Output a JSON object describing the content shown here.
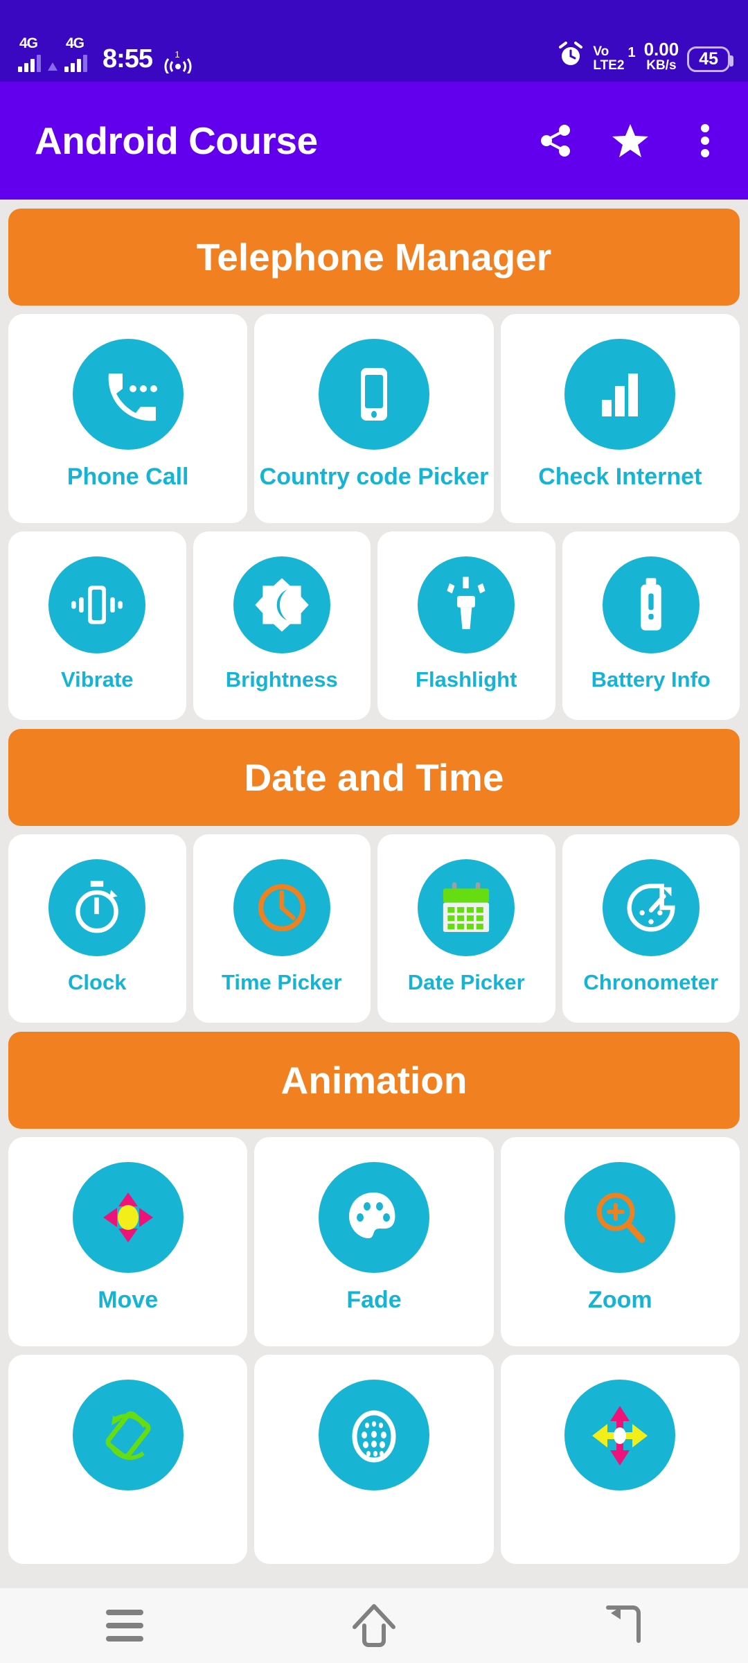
{
  "status_bar": {
    "network_1": "4G",
    "network_2": "4G",
    "time": "8:55",
    "hotspot_count": "1",
    "alarm_icon": "alarm-clock-icon",
    "volte_label": "Vo",
    "volte_sub": "LTE2",
    "sim_number": "1",
    "net_speed_value": "0.00",
    "net_speed_unit": "KB/s",
    "battery_percent": "45"
  },
  "app_bar": {
    "title": "Android Course",
    "actions": [
      {
        "name": "share-icon",
        "label": "Share"
      },
      {
        "name": "star-icon",
        "label": "Favorite"
      },
      {
        "name": "overflow-menu-icon",
        "label": "More options"
      }
    ]
  },
  "sections": [
    {
      "header": "Telephone Manager",
      "rows": [
        {
          "size": "r3",
          "items": [
            {
              "label": "Phone Call",
              "icon": "phone-call-icon"
            },
            {
              "label": "Country code Picker",
              "icon": "smartphone-icon"
            },
            {
              "label": "Check Internet",
              "icon": "signal-bars-icon"
            }
          ]
        },
        {
          "size": "r4",
          "items": [
            {
              "label": "Vibrate",
              "icon": "vibrate-icon"
            },
            {
              "label": "Brightness",
              "icon": "brightness-icon"
            },
            {
              "label": "Flashlight",
              "icon": "flashlight-icon"
            },
            {
              "label": "Battery Info",
              "icon": "battery-icon"
            }
          ]
        }
      ]
    },
    {
      "header": "Date and Time",
      "rows": [
        {
          "size": "r4",
          "items": [
            {
              "label": "Clock",
              "icon": "stopwatch-icon"
            },
            {
              "label": "Time Picker",
              "icon": "analog-clock-icon"
            },
            {
              "label": "Date Picker",
              "icon": "calendar-icon"
            },
            {
              "label": "Chronometer",
              "icon": "speedometer-icon"
            }
          ]
        }
      ]
    },
    {
      "header": "Animation",
      "rows": [
        {
          "size": "r3",
          "items": [
            {
              "label": "Move",
              "icon": "move-arrows-icon"
            },
            {
              "label": "Fade",
              "icon": "palette-icon"
            },
            {
              "label": "Zoom",
              "icon": "magnifier-plus-icon"
            }
          ]
        },
        {
          "size": "r3 partial",
          "items": [
            {
              "label": "",
              "icon": "rotate-icon"
            },
            {
              "label": "",
              "icon": "blink-dots-icon"
            },
            {
              "label": "",
              "icon": "slide-arrows-icon"
            }
          ]
        }
      ]
    }
  ],
  "nav_bar": {
    "items": [
      {
        "name": "recents-button",
        "label": "Recents"
      },
      {
        "name": "home-button",
        "label": "Home"
      },
      {
        "name": "back-button",
        "label": "Back"
      }
    ]
  },
  "colors": {
    "status_bar_bg": "#3A08C0",
    "app_bar_bg": "#6200EE",
    "page_bg": "#EAE8E6",
    "section_header_bg": "#F18021",
    "icon_circle": "#17B4D3",
    "label_text": "#16B4D4",
    "accent_orange": "#F0811F",
    "accent_green": "#66DD11",
    "accent_pink": "#EE1379",
    "accent_yellow": "#F2EE1A",
    "card_bg": "#FFFFFF"
  }
}
